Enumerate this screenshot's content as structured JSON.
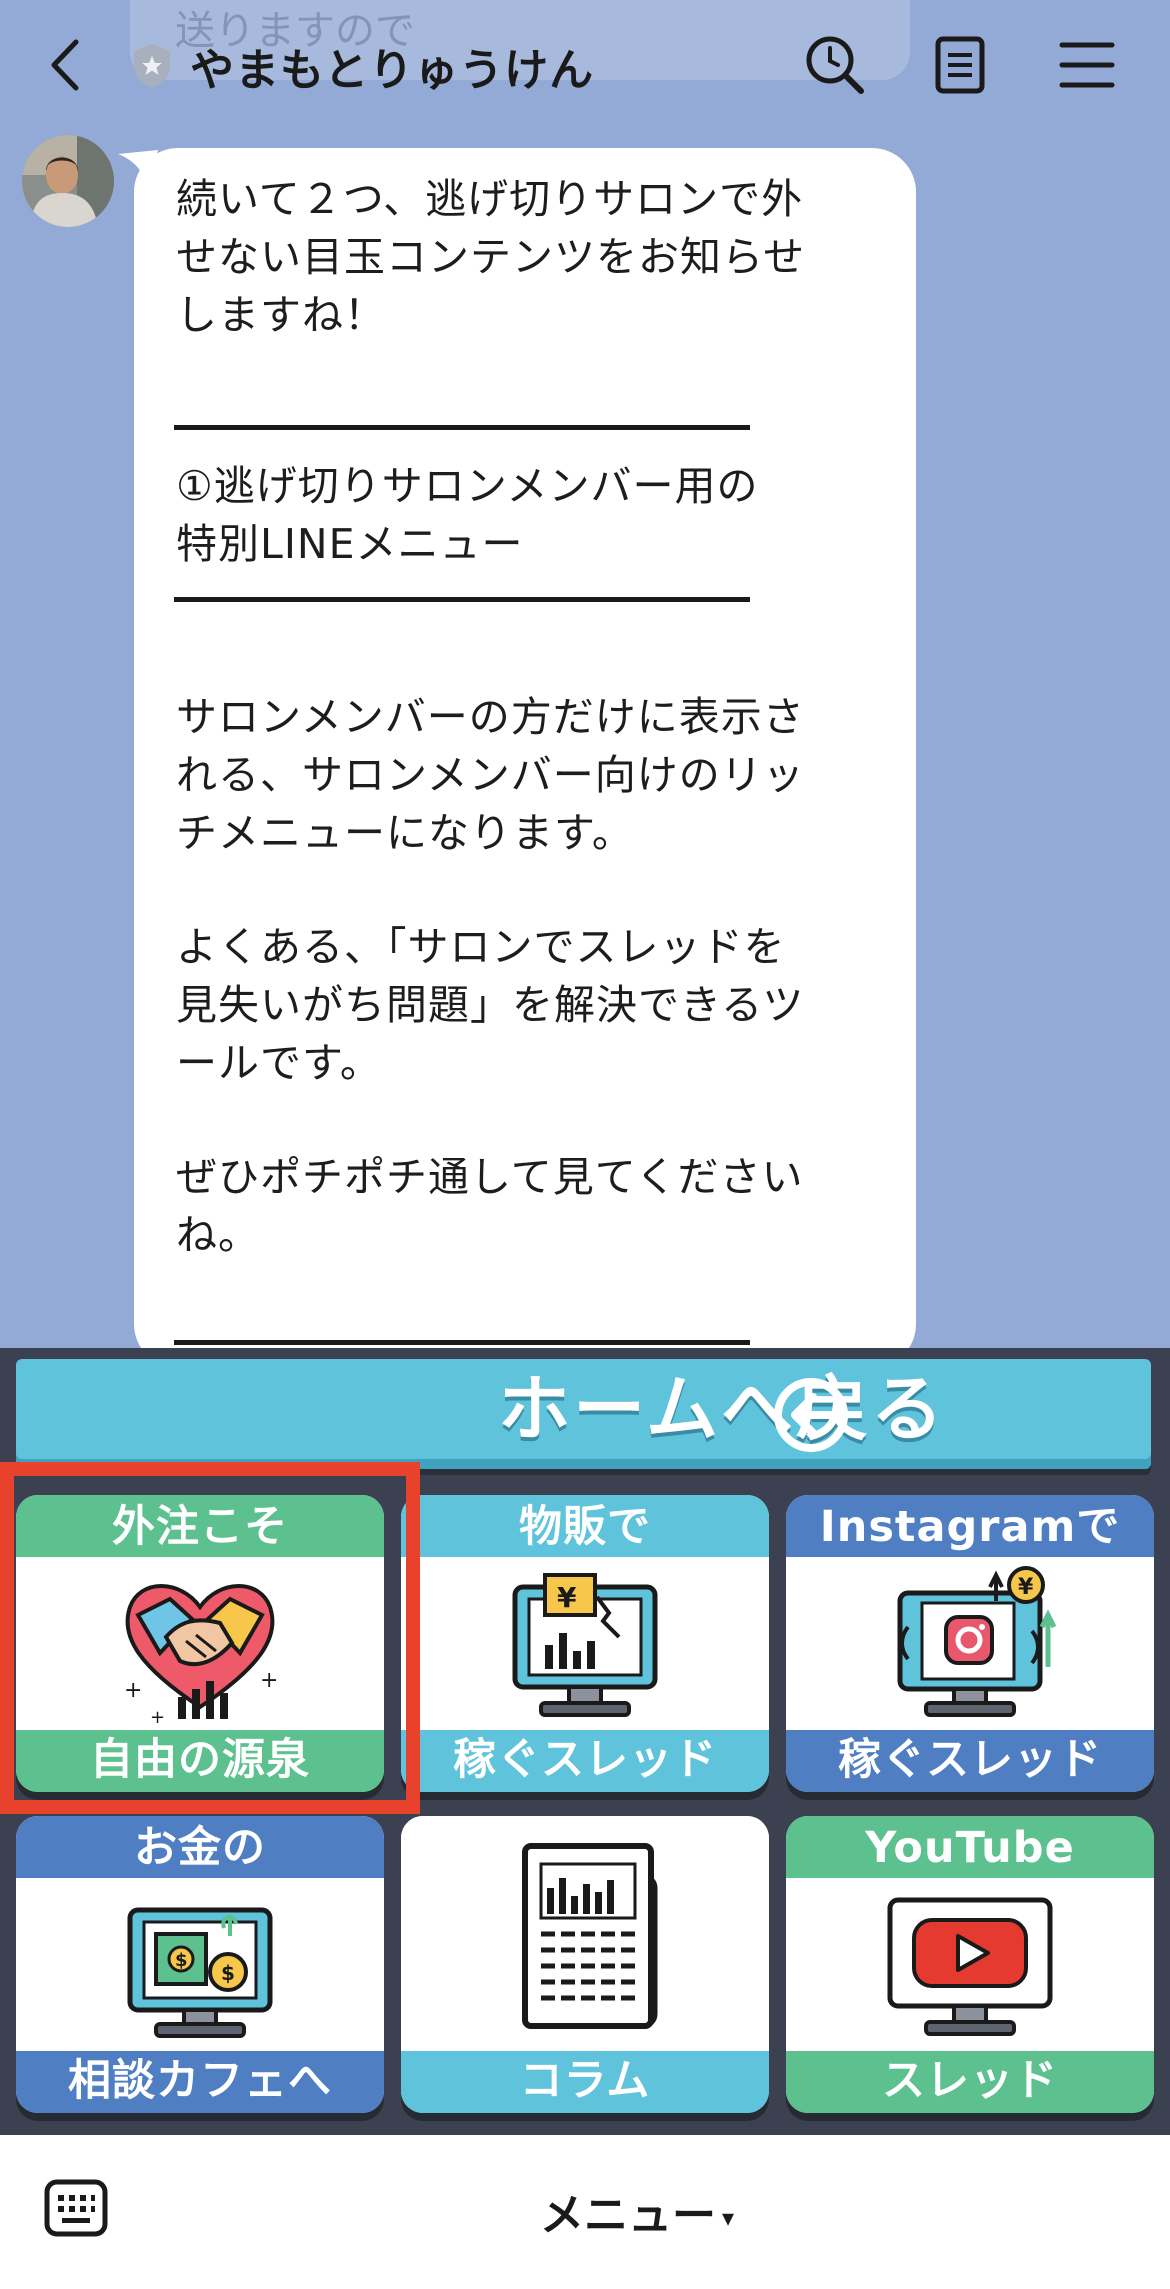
{
  "header": {
    "title": "やまもとりゅうけん",
    "faded_previous_text": "送りますので"
  },
  "message": {
    "lines": [
      "続いて２つ、逃げ切りサロンで外",
      "せない目玉コンテンツをお知らせ",
      "しますね！",
      "①逃げ切りサロンメンバー用の",
      "特別LINEメニュー",
      "サロンメンバーの方だけに表示さ",
      "れる、サロンメンバー向けのリッ",
      "チメニューになります。",
      "よくある、「サロンでスレッドを",
      "見失いがち問題」を解決できるツ",
      "ールです。",
      "ぜひポチポチ通して見てください",
      "ね。"
    ]
  },
  "rich_menu": {
    "home_label": "ホームへ戻る",
    "tiles": [
      {
        "top": "外注こそ",
        "bottom": "自由の源泉",
        "icon": "handshake-heart-icon"
      },
      {
        "top": "物販で",
        "bottom": "稼ぐスレッド",
        "icon": "monitor-yen-chart-icon"
      },
      {
        "top": "Instagramで",
        "bottom": "稼ぐスレッド",
        "icon": "monitor-instagram-icon"
      },
      {
        "top": "お金の",
        "bottom": "相談カフェへ",
        "icon": "monitor-money-icon"
      },
      {
        "top": "",
        "bottom": "コラム",
        "icon": "newspaper-icon"
      },
      {
        "top": "YouTube",
        "bottom": "スレッド",
        "icon": "monitor-youtube-icon"
      }
    ],
    "colors": {
      "green": "#5cc08f",
      "cyan": "#5fc3dc",
      "blue": "#4f7fc2",
      "highlight": "#e8412c"
    }
  },
  "bottom_bar": {
    "menu_label": "メニュー",
    "caret": "▾"
  }
}
